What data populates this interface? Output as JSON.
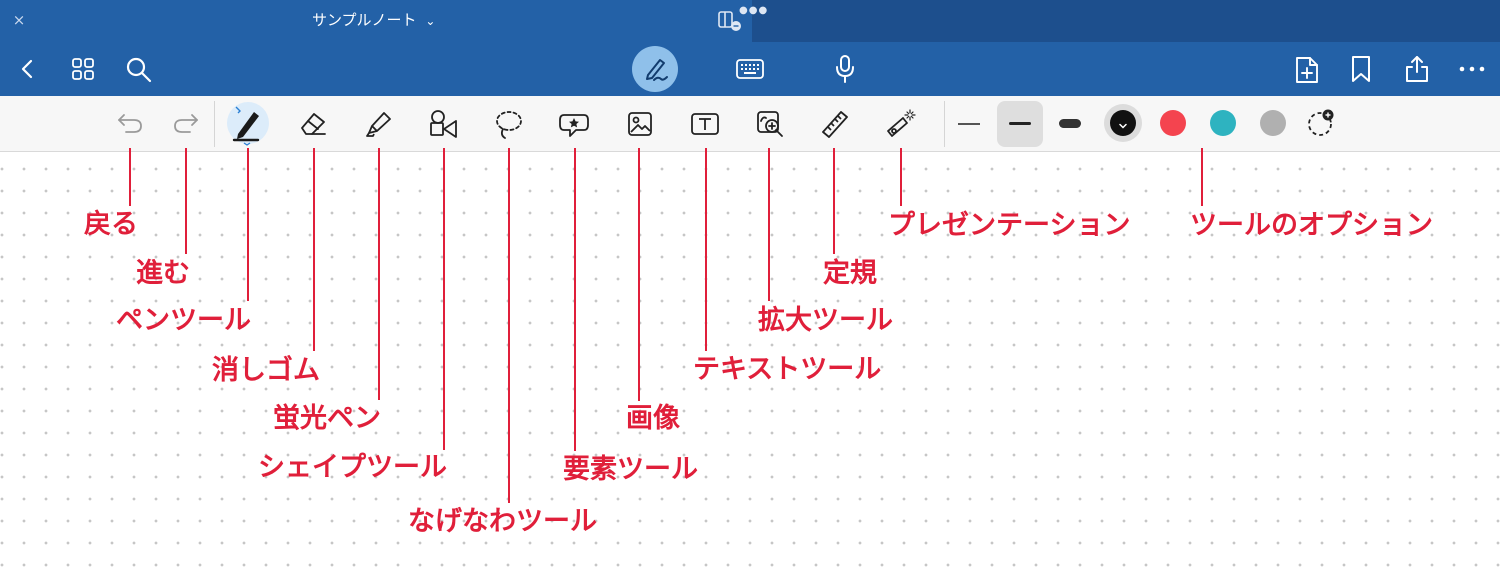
{
  "window": {
    "close_glyph": "×",
    "note_title": "サンプルノート",
    "title_chevron": "⌄"
  },
  "navbar": {
    "left": [
      "back-icon",
      "grid-icon",
      "search-icon"
    ],
    "center": [
      "pen-mode-icon",
      "keyboard-icon",
      "microphone-icon"
    ],
    "right": [
      "add-page-icon",
      "bookmark-icon",
      "share-icon",
      "more-icon"
    ]
  },
  "toolbar": {
    "tools": [
      "undo-icon",
      "redo-icon",
      "pen-tool-icon",
      "eraser-icon",
      "highlighter-icon",
      "shape-tool-icon",
      "lasso-icon",
      "element-tool-icon",
      "image-icon",
      "text-tool-icon",
      "zoom-tool-icon",
      "ruler-icon",
      "presentation-icon"
    ],
    "stroke_widths": [
      "thin",
      "medium",
      "thick"
    ],
    "selected_width": "medium",
    "colors": [
      "#111111",
      "#f4444f",
      "#2eb3c0",
      "#b0b0b0"
    ],
    "selected_color": "#111111"
  },
  "annotations": {
    "back": "戻る",
    "forward": "進む",
    "pen_tool": "ペンツール",
    "eraser": "消しゴム",
    "highlighter": "蛍光ペン",
    "shape_tool": "シェイプツール",
    "lasso": "なげなわツール",
    "element_tool": "要素ツール",
    "image": "画像",
    "text_tool": "テキストツール",
    "zoom_tool": "拡大ツール",
    "ruler": "定規",
    "presentation": "プレゼンテーション",
    "tool_options": "ツールのオプション"
  },
  "colors": {
    "header_blue": "#2361a7",
    "annotation_red": "#e01f3a"
  }
}
